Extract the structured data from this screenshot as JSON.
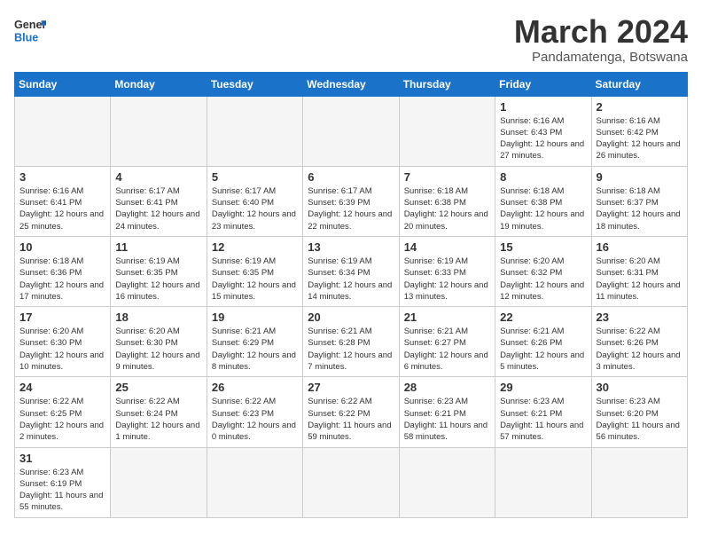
{
  "header": {
    "logo_general": "General",
    "logo_blue": "Blue",
    "month_title": "March 2024",
    "subtitle": "Pandamatenga, Botswana"
  },
  "weekdays": [
    "Sunday",
    "Monday",
    "Tuesday",
    "Wednesday",
    "Thursday",
    "Friday",
    "Saturday"
  ],
  "weeks": [
    [
      {
        "day": "",
        "info": ""
      },
      {
        "day": "",
        "info": ""
      },
      {
        "day": "",
        "info": ""
      },
      {
        "day": "",
        "info": ""
      },
      {
        "day": "",
        "info": ""
      },
      {
        "day": "1",
        "info": "Sunrise: 6:16 AM\nSunset: 6:43 PM\nDaylight: 12 hours and 27 minutes."
      },
      {
        "day": "2",
        "info": "Sunrise: 6:16 AM\nSunset: 6:42 PM\nDaylight: 12 hours and 26 minutes."
      }
    ],
    [
      {
        "day": "3",
        "info": "Sunrise: 6:16 AM\nSunset: 6:41 PM\nDaylight: 12 hours and 25 minutes."
      },
      {
        "day": "4",
        "info": "Sunrise: 6:17 AM\nSunset: 6:41 PM\nDaylight: 12 hours and 24 minutes."
      },
      {
        "day": "5",
        "info": "Sunrise: 6:17 AM\nSunset: 6:40 PM\nDaylight: 12 hours and 23 minutes."
      },
      {
        "day": "6",
        "info": "Sunrise: 6:17 AM\nSunset: 6:39 PM\nDaylight: 12 hours and 22 minutes."
      },
      {
        "day": "7",
        "info": "Sunrise: 6:18 AM\nSunset: 6:38 PM\nDaylight: 12 hours and 20 minutes."
      },
      {
        "day": "8",
        "info": "Sunrise: 6:18 AM\nSunset: 6:38 PM\nDaylight: 12 hours and 19 minutes."
      },
      {
        "day": "9",
        "info": "Sunrise: 6:18 AM\nSunset: 6:37 PM\nDaylight: 12 hours and 18 minutes."
      }
    ],
    [
      {
        "day": "10",
        "info": "Sunrise: 6:18 AM\nSunset: 6:36 PM\nDaylight: 12 hours and 17 minutes."
      },
      {
        "day": "11",
        "info": "Sunrise: 6:19 AM\nSunset: 6:35 PM\nDaylight: 12 hours and 16 minutes."
      },
      {
        "day": "12",
        "info": "Sunrise: 6:19 AM\nSunset: 6:35 PM\nDaylight: 12 hours and 15 minutes."
      },
      {
        "day": "13",
        "info": "Sunrise: 6:19 AM\nSunset: 6:34 PM\nDaylight: 12 hours and 14 minutes."
      },
      {
        "day": "14",
        "info": "Sunrise: 6:19 AM\nSunset: 6:33 PM\nDaylight: 12 hours and 13 minutes."
      },
      {
        "day": "15",
        "info": "Sunrise: 6:20 AM\nSunset: 6:32 PM\nDaylight: 12 hours and 12 minutes."
      },
      {
        "day": "16",
        "info": "Sunrise: 6:20 AM\nSunset: 6:31 PM\nDaylight: 12 hours and 11 minutes."
      }
    ],
    [
      {
        "day": "17",
        "info": "Sunrise: 6:20 AM\nSunset: 6:30 PM\nDaylight: 12 hours and 10 minutes."
      },
      {
        "day": "18",
        "info": "Sunrise: 6:20 AM\nSunset: 6:30 PM\nDaylight: 12 hours and 9 minutes."
      },
      {
        "day": "19",
        "info": "Sunrise: 6:21 AM\nSunset: 6:29 PM\nDaylight: 12 hours and 8 minutes."
      },
      {
        "day": "20",
        "info": "Sunrise: 6:21 AM\nSunset: 6:28 PM\nDaylight: 12 hours and 7 minutes."
      },
      {
        "day": "21",
        "info": "Sunrise: 6:21 AM\nSunset: 6:27 PM\nDaylight: 12 hours and 6 minutes."
      },
      {
        "day": "22",
        "info": "Sunrise: 6:21 AM\nSunset: 6:26 PM\nDaylight: 12 hours and 5 minutes."
      },
      {
        "day": "23",
        "info": "Sunrise: 6:22 AM\nSunset: 6:26 PM\nDaylight: 12 hours and 3 minutes."
      }
    ],
    [
      {
        "day": "24",
        "info": "Sunrise: 6:22 AM\nSunset: 6:25 PM\nDaylight: 12 hours and 2 minutes."
      },
      {
        "day": "25",
        "info": "Sunrise: 6:22 AM\nSunset: 6:24 PM\nDaylight: 12 hours and 1 minute."
      },
      {
        "day": "26",
        "info": "Sunrise: 6:22 AM\nSunset: 6:23 PM\nDaylight: 12 hours and 0 minutes."
      },
      {
        "day": "27",
        "info": "Sunrise: 6:22 AM\nSunset: 6:22 PM\nDaylight: 11 hours and 59 minutes."
      },
      {
        "day": "28",
        "info": "Sunrise: 6:23 AM\nSunset: 6:21 PM\nDaylight: 11 hours and 58 minutes."
      },
      {
        "day": "29",
        "info": "Sunrise: 6:23 AM\nSunset: 6:21 PM\nDaylight: 11 hours and 57 minutes."
      },
      {
        "day": "30",
        "info": "Sunrise: 6:23 AM\nSunset: 6:20 PM\nDaylight: 11 hours and 56 minutes."
      }
    ],
    [
      {
        "day": "31",
        "info": "Sunrise: 6:23 AM\nSunset: 6:19 PM\nDaylight: 11 hours and 55 minutes."
      },
      {
        "day": "",
        "info": ""
      },
      {
        "day": "",
        "info": ""
      },
      {
        "day": "",
        "info": ""
      },
      {
        "day": "",
        "info": ""
      },
      {
        "day": "",
        "info": ""
      },
      {
        "day": "",
        "info": ""
      }
    ]
  ]
}
